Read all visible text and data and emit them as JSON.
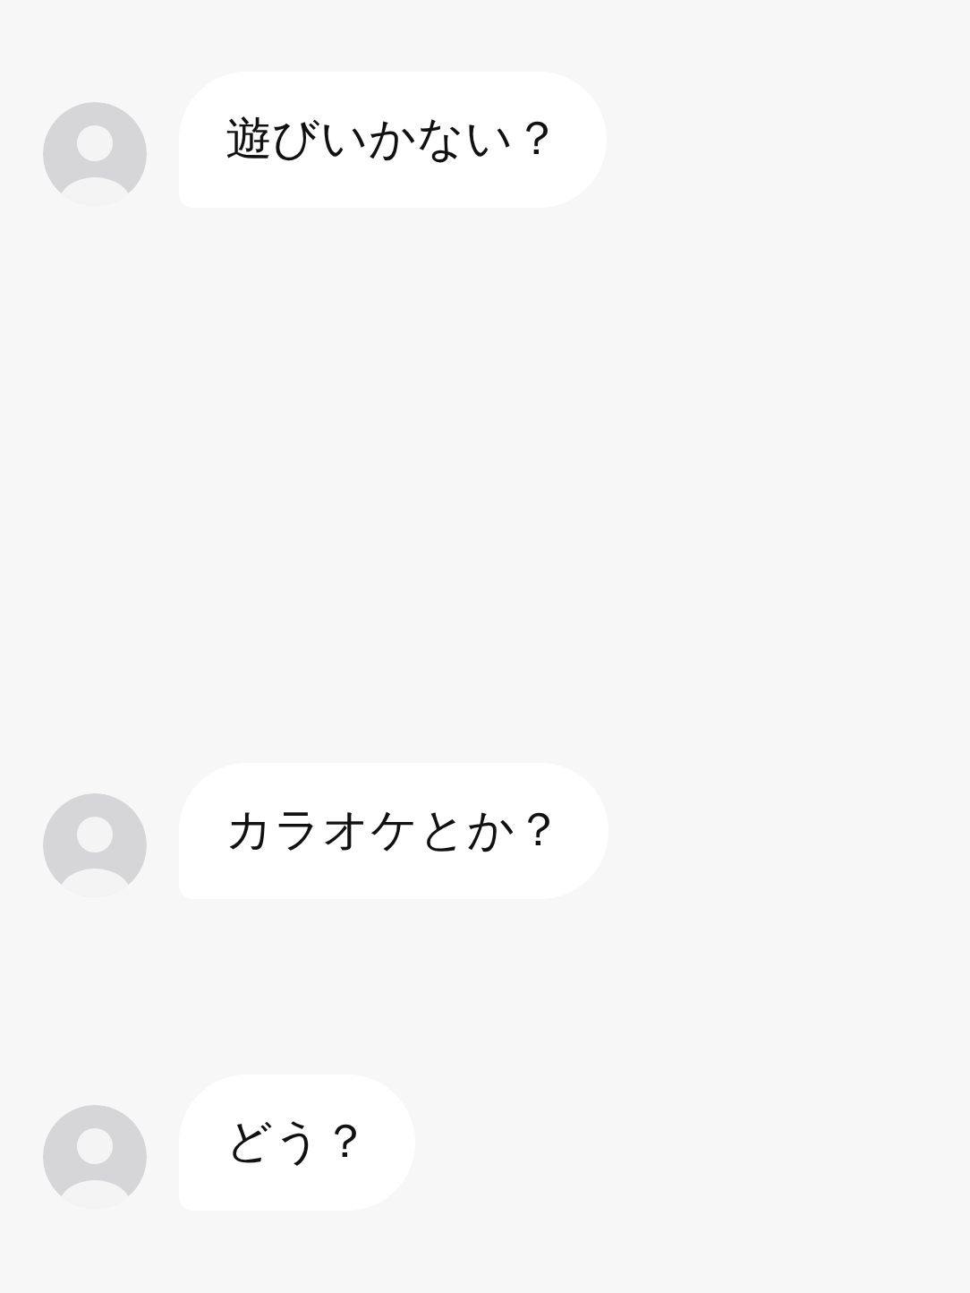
{
  "messages": [
    {
      "text": "遊びいかない？"
    },
    {
      "text": "カラオケとか？"
    },
    {
      "text": "どう？"
    }
  ]
}
